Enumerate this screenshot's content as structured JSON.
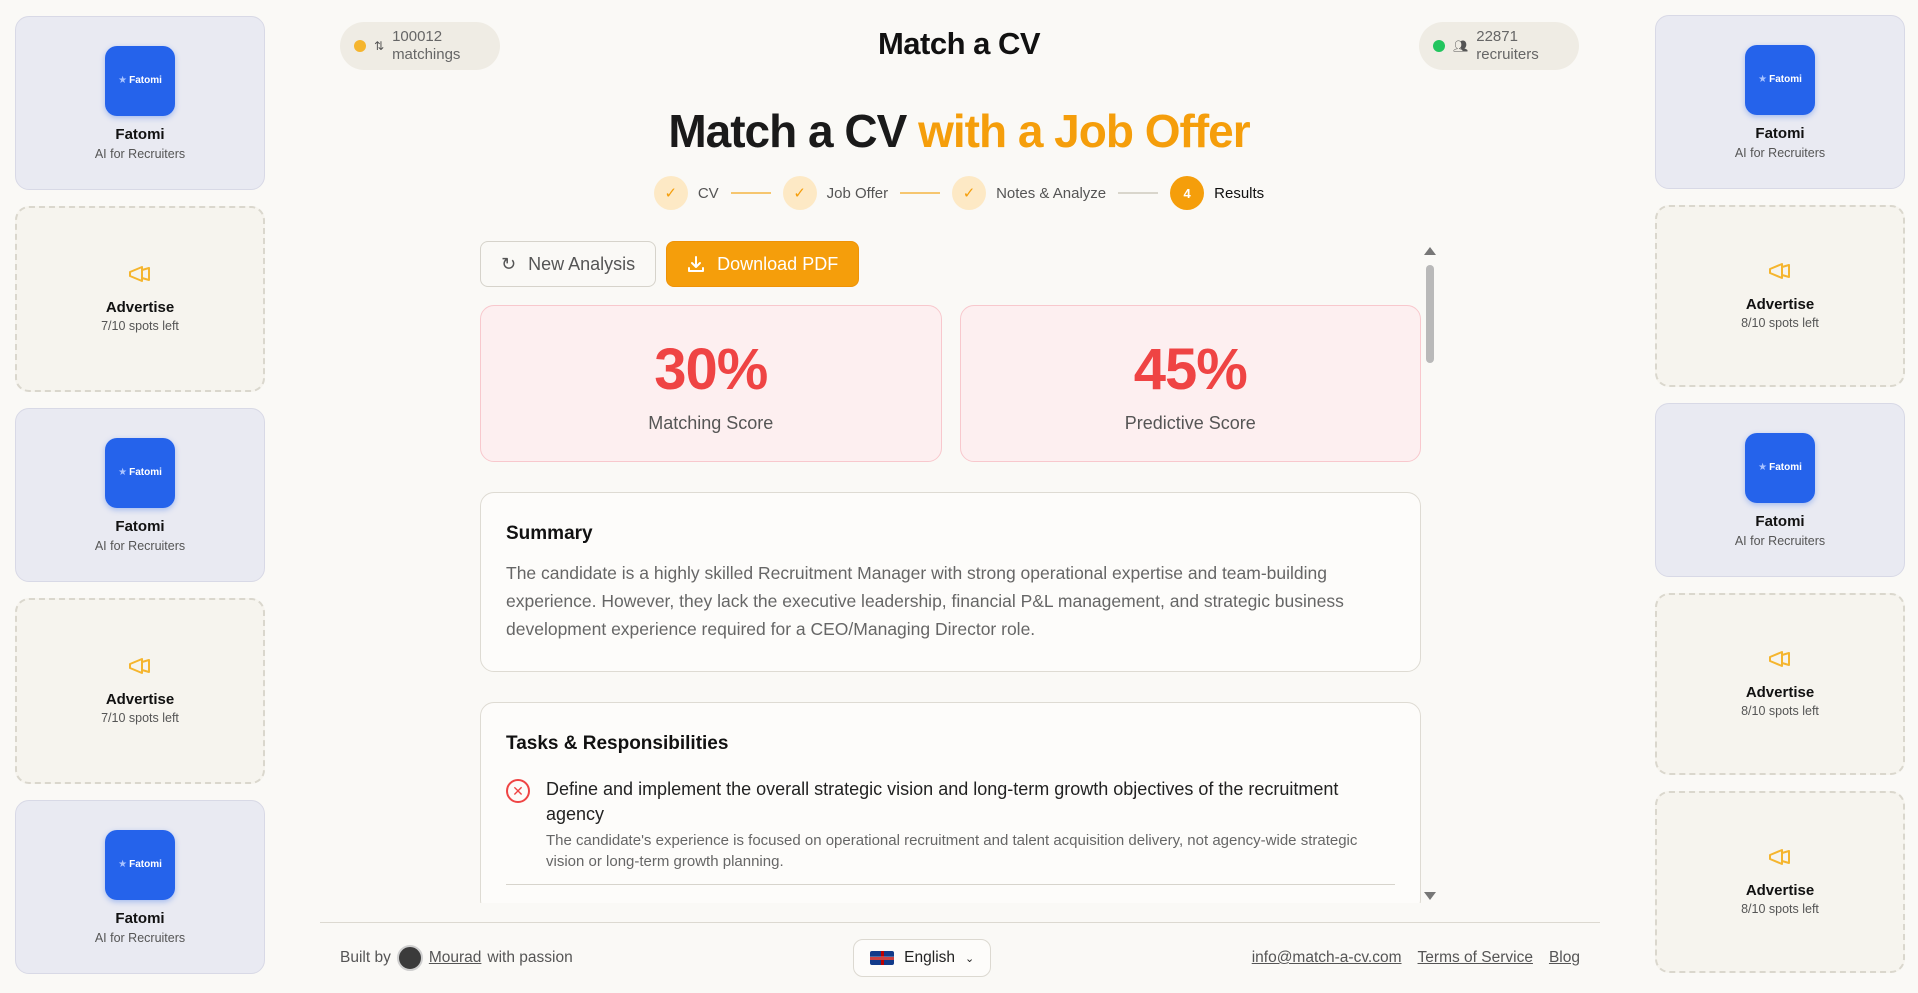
{
  "header": {
    "brand_title": "Match a CV",
    "matchings_count": "100012",
    "matchings_label": "matchings",
    "recruiters_count": "22871",
    "recruiters_label": "recruiters"
  },
  "hero": {
    "title_main": "Match a CV",
    "title_accent": "with a Job Offer"
  },
  "stepper": {
    "steps": [
      {
        "label": "CV",
        "mark": "✓"
      },
      {
        "label": "Job Offer",
        "mark": "✓"
      },
      {
        "label": "Notes & Analyze",
        "mark": "✓"
      },
      {
        "label": "Results",
        "mark": "4"
      }
    ]
  },
  "actions": {
    "new_analysis": "New Analysis",
    "download_pdf": "Download PDF"
  },
  "scores": {
    "matching_value": "30%",
    "matching_label": "Matching Score",
    "predictive_value": "45%",
    "predictive_label": "Predictive Score"
  },
  "summary": {
    "heading": "Summary",
    "text": "The candidate is a highly skilled Recruitment Manager with strong operational expertise and team-building experience. However, they lack the executive leadership, financial P&L management, and strategic business development experience required for a CEO/Managing Director role."
  },
  "tasks": {
    "heading": "Tasks & Responsibilities",
    "items": [
      {
        "title": "Define and implement the overall strategic vision and long-term growth objectives of the recruitment agency",
        "desc": "The candidate's experience is focused on operational recruitment and talent acquisition delivery, not agency-wide strategic vision or long-term growth planning."
      }
    ]
  },
  "ads_left": [
    {
      "type": "brand",
      "logo": "Fatomi",
      "name": "Fatomi",
      "tagline": "AI for Recruiters"
    },
    {
      "type": "advertise",
      "title": "Advertise",
      "spots": "7/10 spots left"
    },
    {
      "type": "brand",
      "logo": "Fatomi",
      "name": "Fatomi",
      "tagline": "AI for Recruiters"
    },
    {
      "type": "advertise",
      "title": "Advertise",
      "spots": "7/10 spots left"
    },
    {
      "type": "brand",
      "logo": "Fatomi",
      "name": "Fatomi",
      "tagline": "AI for Recruiters"
    }
  ],
  "ads_right": [
    {
      "type": "brand",
      "logo": "Fatomi",
      "name": "Fatomi",
      "tagline": "AI for Recruiters"
    },
    {
      "type": "advertise",
      "title": "Advertise",
      "spots": "8/10 spots left"
    },
    {
      "type": "brand",
      "logo": "Fatomi",
      "name": "Fatomi",
      "tagline": "AI for Recruiters"
    },
    {
      "type": "advertise",
      "title": "Advertise",
      "spots": "8/10 spots left"
    },
    {
      "type": "advertise",
      "title": "Advertise",
      "spots": "8/10 spots left"
    }
  ],
  "footer": {
    "built_by": "Built by",
    "author": "Mourad",
    "with_passion": "with passion",
    "language": "English",
    "email": "info@match-a-cv.com",
    "terms": "Terms of Service",
    "blog": "Blog"
  },
  "colors": {
    "accent": "#f59e0b",
    "score_red": "#ef4444",
    "brand_blue": "#2563eb",
    "online_green": "#22c55e"
  },
  "icons": [
    "swap-icon",
    "users-icon",
    "refresh-icon",
    "download-icon",
    "megaphone-icon",
    "x-circle-icon",
    "chevron-down-icon",
    "uk-flag-icon",
    "star-icon"
  ]
}
